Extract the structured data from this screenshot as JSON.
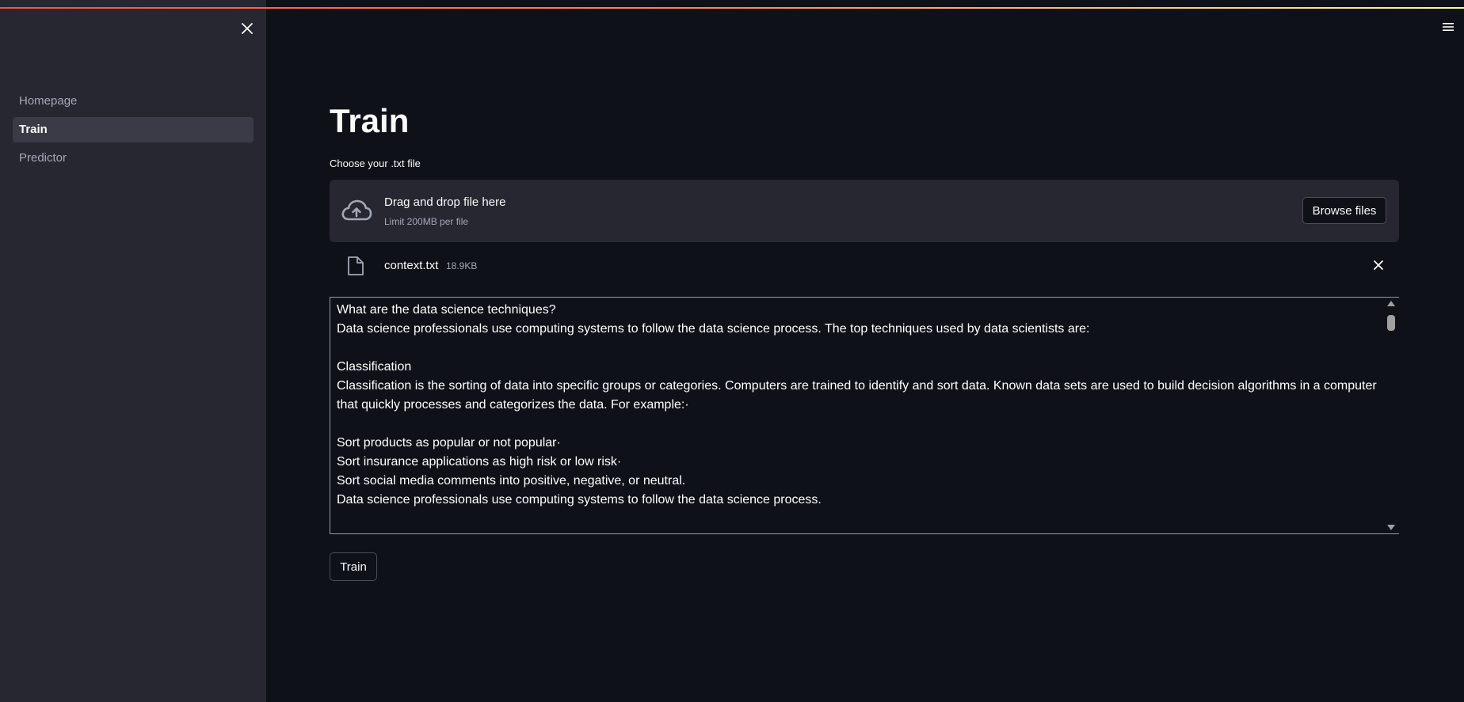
{
  "sidebar": {
    "items": [
      {
        "label": "Homepage",
        "active": false
      },
      {
        "label": "Train",
        "active": true
      },
      {
        "label": "Predictor",
        "active": false
      }
    ]
  },
  "main": {
    "title": "Train",
    "uploader": {
      "label": "Choose your .txt file",
      "drop_title": "Drag and drop file here",
      "limit": "Limit 200MB per file",
      "browse_label": "Browse files"
    },
    "file": {
      "name": "context.txt",
      "size": "18.9KB"
    },
    "textarea_value": "What are the data science techniques?\nData science professionals use computing systems to follow the data science process. The top techniques used by data scientists are:\n\nClassification\nClassification is the sorting of data into specific groups or categories. Computers are trained to identify and sort data. Known data sets are used to build decision algorithms in a computer that quickly processes and categorizes the data. For example:·\n\nSort products as popular or not popular·\nSort insurance applications as high risk or low risk·\nSort social media comments into positive, negative, or neutral.\nData science professionals use computing systems to follow the data science process.\n\nRegression",
    "train_button": "Train"
  },
  "colors": {
    "background": "#0e1117",
    "sidebar": "#262730",
    "text": "#fafafa",
    "muted": "#a3a8b8",
    "accent_gradient": [
      "#ff4b4b",
      "#fffd80"
    ]
  },
  "icons": {
    "sidebar_close": "close-icon",
    "menu": "hamburger-menu-icon",
    "upload": "cloud-upload-icon",
    "file": "file-icon",
    "remove": "close-icon"
  }
}
